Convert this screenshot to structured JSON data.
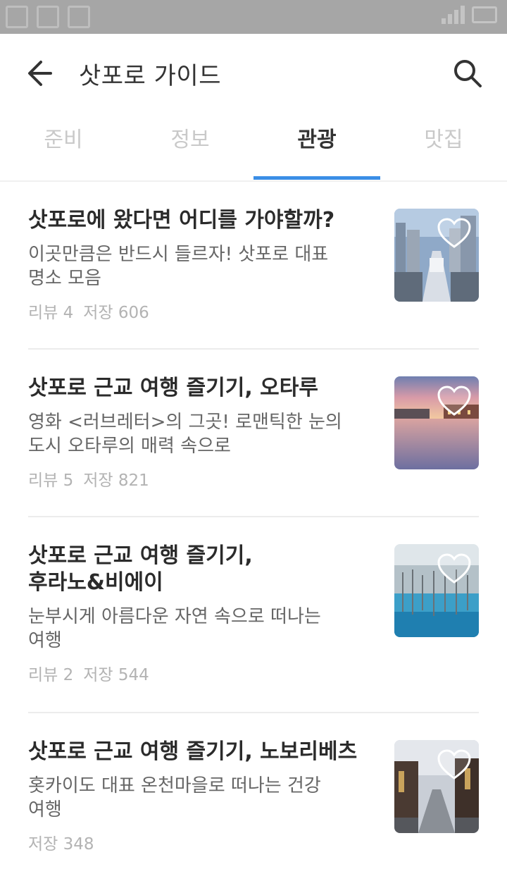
{
  "header": {
    "title": "삿포로 가이드"
  },
  "tabs": [
    {
      "label": "준비",
      "active": false
    },
    {
      "label": "정보",
      "active": false
    },
    {
      "label": "관광",
      "active": true
    },
    {
      "label": "맛집",
      "active": false
    }
  ],
  "colors": {
    "accent": "#3a8ee6",
    "statusbar": "#a6a6a6"
  },
  "icons": [
    "back-arrow-icon",
    "search-icon",
    "heart-icon"
  ],
  "items": [
    {
      "title": "삿포로에 왔다면 어디를 가야할까?",
      "desc1": "이곳만큼은 반드시 들르자! 삿포로 대표",
      "desc2": "명소 모음",
      "review_label": "리뷰 4",
      "save_label": "저장 606"
    },
    {
      "title": "삿포로 근교 여행 즐기기, 오타루",
      "desc1": "영화 <러브레터>의 그곳! 로맨틱한 눈의",
      "desc2": "도시 오타루의 매력 속으로",
      "review_label": "리뷰 5",
      "save_label": "저장 821"
    },
    {
      "title1": "삿포로 근교 여행 즐기기,",
      "title2": "후라노&비에이",
      "desc1": "눈부시게 아름다운 자연 속으로 떠나는",
      "desc2": "여행",
      "review_label": "리뷰 2",
      "save_label": "저장 544"
    },
    {
      "title": "삿포로 근교 여행 즐기기, 노보리베츠",
      "desc1": "홋카이도 대표 온천마을로 떠나는 건강",
      "desc2": "여행",
      "save_label": "저장 348"
    }
  ]
}
